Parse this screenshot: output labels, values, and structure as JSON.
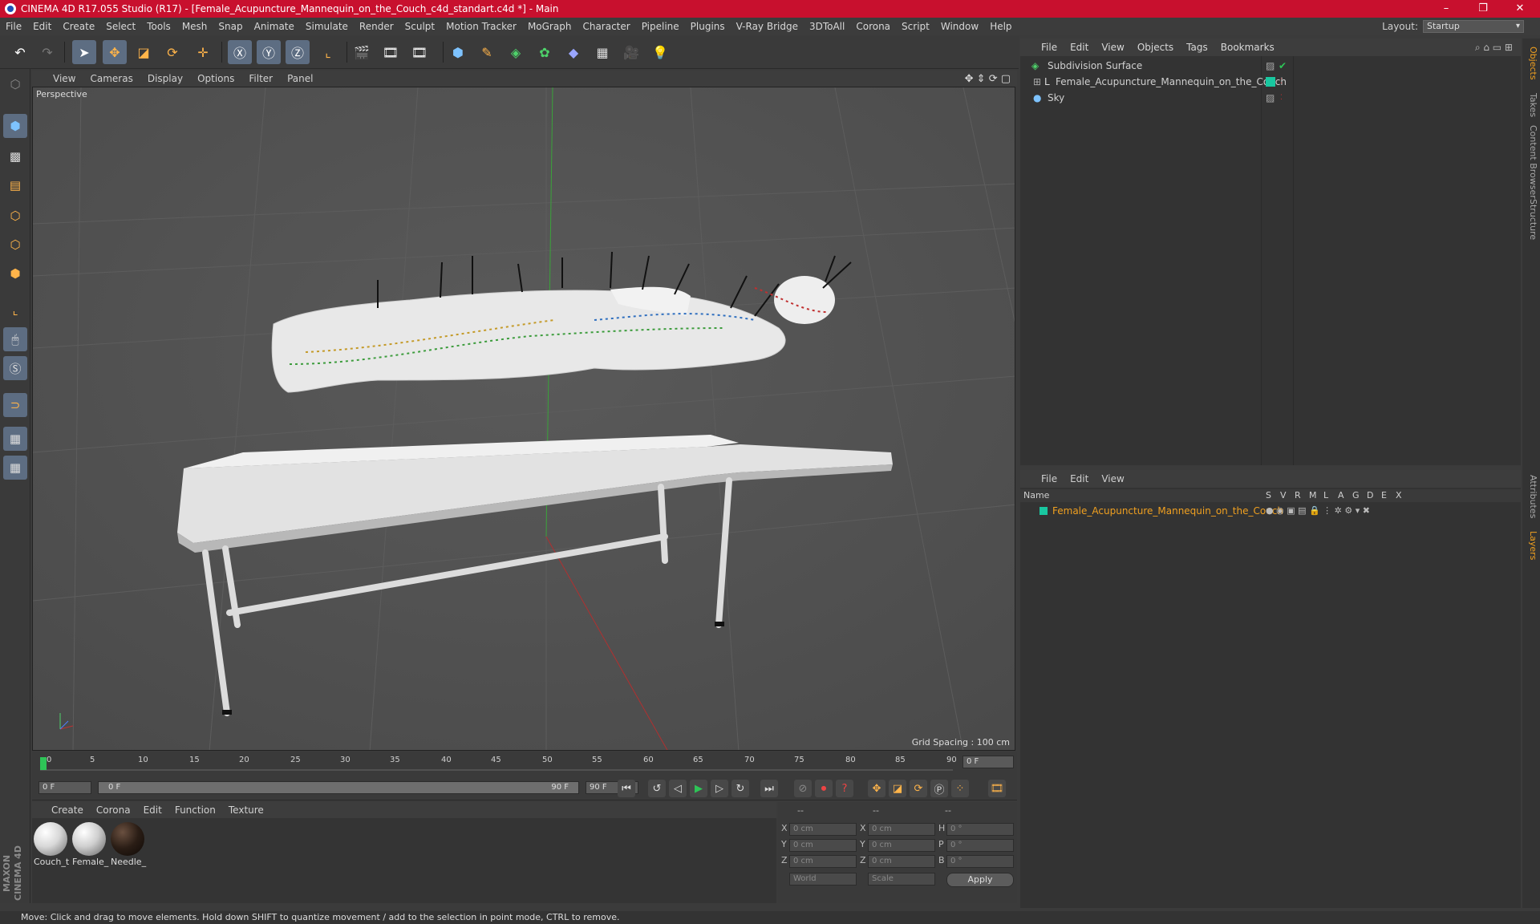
{
  "window": {
    "title": "CINEMA 4D R17.055 Studio (R17) - [Female_Acupuncture_Mannequin_on_the_Couch_c4d_standart.c4d *] - Main",
    "minimize": "–",
    "maximize": "❐",
    "close": "✕"
  },
  "menu": [
    "File",
    "Edit",
    "Create",
    "Select",
    "Tools",
    "Mesh",
    "Snap",
    "Animate",
    "Simulate",
    "Render",
    "Sculpt",
    "Motion Tracker",
    "MoGraph",
    "Character",
    "Pipeline",
    "Plugins",
    "V-Ray Bridge",
    "3DToAll",
    "Corona",
    "Script",
    "Window",
    "Help"
  ],
  "layout": {
    "label": "Layout:",
    "value": "Startup"
  },
  "viewport": {
    "menu": [
      "View",
      "Cameras",
      "Display",
      "Options",
      "Filter",
      "Panel"
    ],
    "label": "Perspective",
    "grid_spacing": "Grid Spacing : 100 cm"
  },
  "timeline": {
    "ticks": [
      "0",
      "5",
      "10",
      "15",
      "20",
      "25",
      "30",
      "35",
      "40",
      "45",
      "50",
      "55",
      "60",
      "65",
      "70",
      "75",
      "80",
      "85",
      "90"
    ],
    "current_frame": "0 F",
    "start_field": "0 F",
    "range_start": "0 F",
    "range_end": "90 F",
    "end_field": "90 F"
  },
  "material_manager": {
    "menu": [
      "Create",
      "Corona",
      "Edit",
      "Function",
      "Texture"
    ],
    "materials": [
      {
        "name": "Couch_t",
        "color": "#d8d8d8"
      },
      {
        "name": "Female_",
        "color": "#cfcfcf"
      },
      {
        "name": "Needle_",
        "color": "#2a1d15"
      }
    ]
  },
  "coords": {
    "headers": [
      "--",
      "--",
      "--"
    ],
    "rows": [
      {
        "a": "X",
        "av": "0 cm",
        "b": "X",
        "bv": "0 cm",
        "c": "H",
        "cv": "0 °"
      },
      {
        "a": "Y",
        "av": "0 cm",
        "b": "Y",
        "bv": "0 cm",
        "c": "P",
        "cv": "0 °"
      },
      {
        "a": "Z",
        "av": "0 cm",
        "b": "Z",
        "bv": "0 cm",
        "c": "B",
        "cv": "0 °"
      }
    ],
    "world": "World",
    "scale": "Scale",
    "apply": "Apply"
  },
  "object_manager": {
    "menu": [
      "File",
      "Edit",
      "View",
      "Objects",
      "Tags",
      "Bookmarks"
    ],
    "objects": [
      {
        "name": "Subdivision Surface",
        "color": "#d0d0d0"
      },
      {
        "name": "Female_Acupuncture_Mannequin_on_the_Couch",
        "color": "#d0d0d0"
      },
      {
        "name": "Sky",
        "color": "#d0d0d0"
      }
    ]
  },
  "layer_manager": {
    "menu": [
      "File",
      "Edit",
      "View"
    ],
    "header": {
      "name": "Name",
      "cols": [
        "S",
        "V",
        "R",
        "M",
        "L",
        "A",
        "G",
        "D",
        "E",
        "X"
      ]
    },
    "layers": [
      {
        "name": "Female_Acupuncture_Mannequin_on_the_Couch",
        "color": "#f0a020"
      }
    ]
  },
  "right_tabs": [
    "Objects",
    "Takes",
    "Content Browser",
    "Structure",
    "Attributes",
    "Layers"
  ],
  "status": "Move: Click and drag to move elements. Hold down SHIFT to quantize movement / add to the selection in point mode, CTRL to remove.",
  "brand": "MAXON CINEMA 4D"
}
